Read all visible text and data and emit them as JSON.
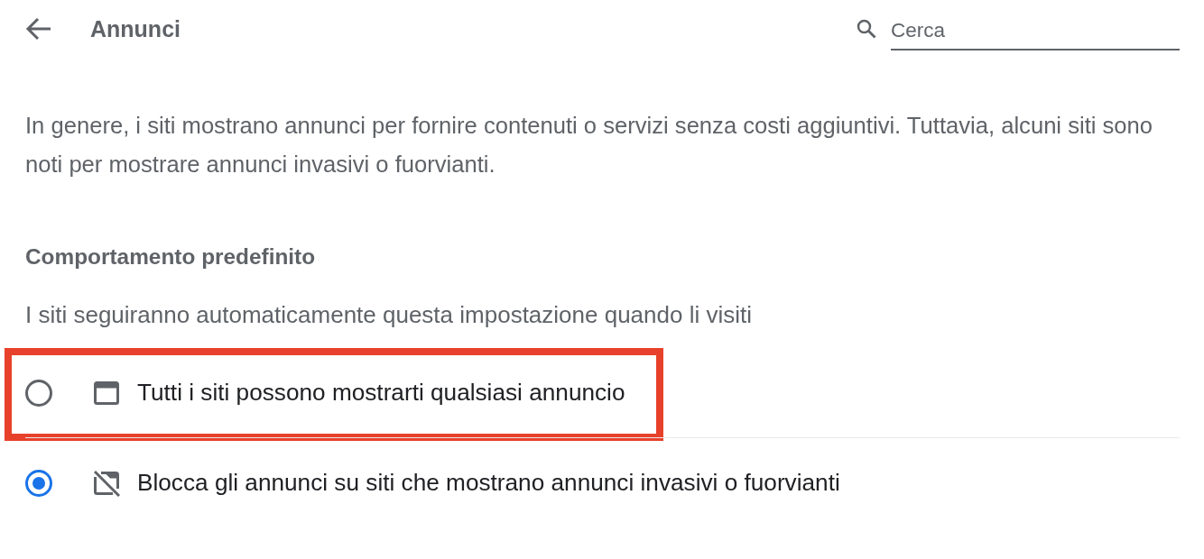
{
  "header": {
    "title": "Annunci",
    "search": {
      "placeholder": "Cerca"
    }
  },
  "description": "In genere, i siti mostrano annunci per fornire contenuti o servizi senza costi aggiuntivi. Tuttavia, alcuni siti sono noti per mostrare annunci invasivi o fuorvianti.",
  "section": {
    "title": "Comportamento predefinito",
    "subtitle": "I siti seguiranno automaticamente questa impostazione quando li visiti"
  },
  "options": [
    {
      "kind": "allow",
      "label": "Tutti i siti possono mostrarti qualsiasi annuncio",
      "selected": false,
      "highlighted": true
    },
    {
      "kind": "block",
      "label": "Blocca gli annunci su siti che mostrano annunci invasivi o fuorvianti",
      "selected": true,
      "highlighted": false
    }
  ]
}
